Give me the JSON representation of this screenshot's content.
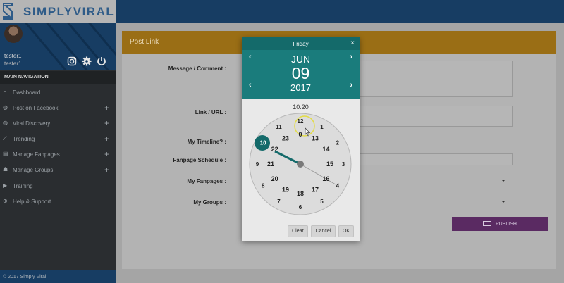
{
  "brand": {
    "name": "SIMPLYVIRAL"
  },
  "user": {
    "name": "tester1",
    "subname": "tester1"
  },
  "sidebar": {
    "section_label": "MAIN NAVIGATION",
    "items": [
      {
        "label": "Dashboard",
        "icon": "dashboard-icon",
        "expandable": false
      },
      {
        "label": "Post on Facebook",
        "icon": "compass-icon",
        "expandable": true
      },
      {
        "label": "Viral Discovery",
        "icon": "compass-icon",
        "expandable": true
      },
      {
        "label": "Trending",
        "icon": "chart-icon",
        "expandable": true
      },
      {
        "label": "Manage Fanpages",
        "icon": "page-icon",
        "expandable": true
      },
      {
        "label": "Manage Groups",
        "icon": "users-icon",
        "expandable": true
      },
      {
        "label": "Training",
        "icon": "video-icon",
        "expandable": false
      },
      {
        "label": "Help & Support",
        "icon": "lifebuoy-icon",
        "expandable": false
      }
    ],
    "footer": "© 2017 Simply Viral."
  },
  "card": {
    "title": "Post Link",
    "labels": {
      "message": "Messege / Comment :",
      "link": "Link / URL :",
      "timeline": "My Timeline? :",
      "schedule": "Fanpage Schedule :",
      "fanpages": "My Fanpages :",
      "groups": "My Groups :"
    },
    "publish_label": "PUBLISH"
  },
  "datepicker": {
    "weekday": "Friday",
    "month": "JUN",
    "day": "09",
    "year": "2017",
    "time": "10:20",
    "selected_hour": "10",
    "outer_hours": [
      "12",
      "1",
      "2",
      "3",
      "4",
      "5",
      "6",
      "7",
      "8",
      "9",
      "10",
      "11"
    ],
    "inner_hours": [
      "0",
      "13",
      "14",
      "15",
      "16",
      "17",
      "18",
      "19",
      "20",
      "21",
      "22",
      "23"
    ],
    "buttons": {
      "clear": "Clear",
      "cancel": "Cancel",
      "ok": "OK"
    }
  },
  "colors": {
    "accent": "#1a7c7c",
    "header": "#173d63",
    "card_head": "#9a6e15",
    "publish": "#5a2a62"
  }
}
